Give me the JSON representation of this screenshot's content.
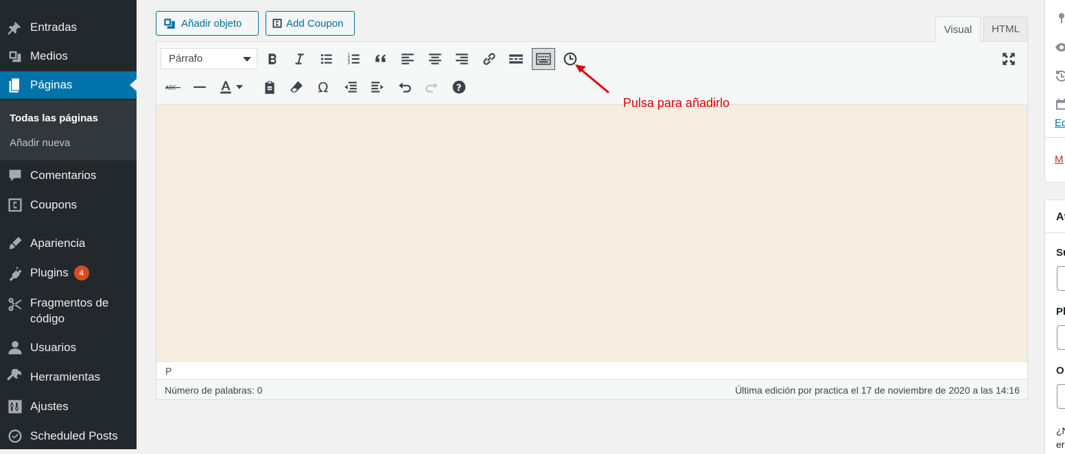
{
  "sidebar": {
    "items": [
      {
        "label": "Entradas",
        "icon": "pin-icon"
      },
      {
        "label": "Medios",
        "icon": "media-icon"
      },
      {
        "label": "Páginas",
        "icon": "pages-icon"
      },
      {
        "label": "Comentarios",
        "icon": "comment-icon"
      },
      {
        "label": "Coupons",
        "icon": "coupon-icon"
      },
      {
        "label": "Apariencia",
        "icon": "brush-icon"
      },
      {
        "label": "Plugins",
        "icon": "plugin-icon",
        "badge": "4"
      },
      {
        "label": "Fragmentos de",
        "label2": "código",
        "icon": "scissors-icon"
      },
      {
        "label": "Usuarios",
        "icon": "user-icon"
      },
      {
        "label": "Herramientas",
        "icon": "wrench-icon"
      },
      {
        "label": "Ajustes",
        "icon": "sliders-icon"
      },
      {
        "label": "Scheduled Posts",
        "icon": "clock-check-icon"
      }
    ],
    "submenu": [
      "Todas las páginas",
      "Añadir nueva"
    ],
    "active_color": "#0073aa",
    "badge_color": "#d54e21"
  },
  "media_buttons": {
    "add_object": "Añadir objeto",
    "add_coupon": "Add Coupon"
  },
  "editor_tabs": {
    "visual": "Visual",
    "html": "HTML"
  },
  "toolbar": {
    "format_select": "Párrafo",
    "row1_icons": [
      "bold-icon",
      "italic-icon",
      "bullet-list-icon",
      "numbered-list-icon",
      "blockquote-icon",
      "align-left-icon",
      "align-center-icon",
      "align-right-icon",
      "link-icon",
      "read-more-icon",
      "toolbar-toggle-icon",
      "clock-icon"
    ],
    "row2_icons": [
      "strikethrough-icon",
      "horizontal-line-icon",
      "text-color-icon",
      "paste-text-icon",
      "clear-formatting-icon",
      "special-character-icon",
      "outdent-icon",
      "indent-icon",
      "undo-icon",
      "redo-icon",
      "help-icon"
    ],
    "fullscreen_icon": "fullscreen-icon"
  },
  "editor": {
    "content_bg": "#f5eee0",
    "path": "P",
    "word_count": "Número de palabras: 0",
    "last_edit": "Última edición por practica el 17 de noviembre de 2020 a las 14:16"
  },
  "annotation": {
    "text": "Pulsa para añadirlo",
    "color": "#e00000"
  },
  "right_panel": {
    "edit_link": "Ed",
    "trash_link": "M",
    "box_title": "At",
    "field1_label": "Su",
    "field2_label": "Pl",
    "field3_label": "O",
    "help_line1": "¿N",
    "help_line2": "er"
  }
}
